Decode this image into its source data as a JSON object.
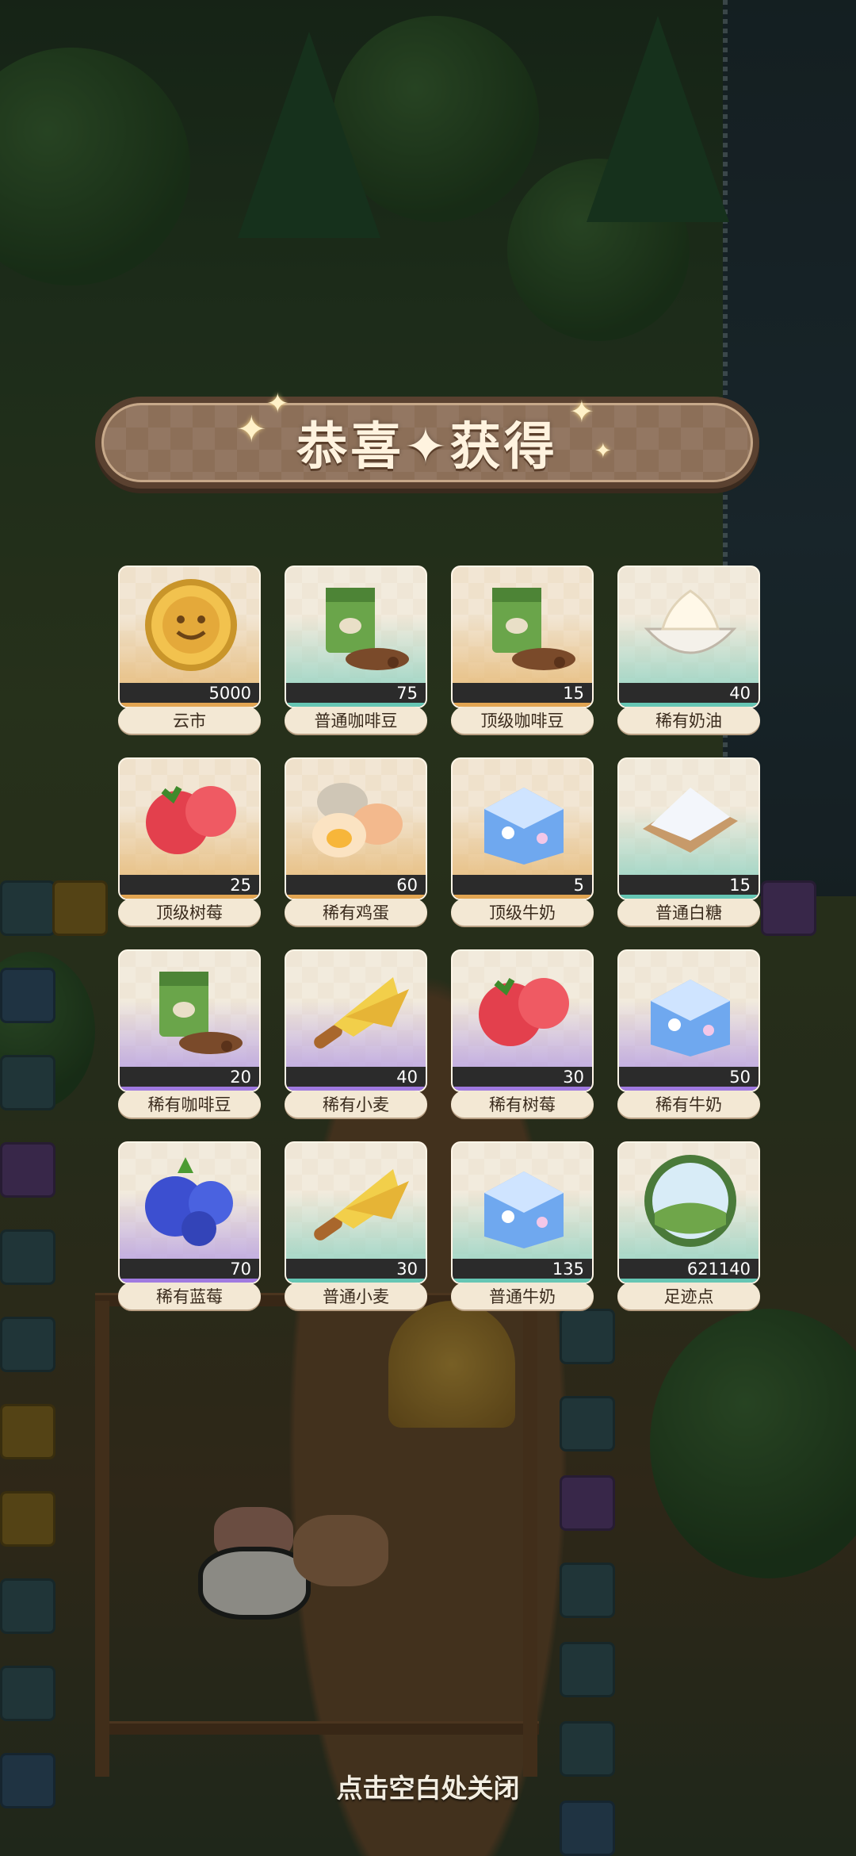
{
  "banner": {
    "title": "恭喜✦获得"
  },
  "rewards": [
    {
      "name": "云市",
      "count": "5000",
      "rarity": "gold",
      "icon": "coin-icon"
    },
    {
      "name": "普通咖啡豆",
      "count": "75",
      "rarity": "teal",
      "icon": "coffee-bean-bag-icon"
    },
    {
      "name": "顶级咖啡豆",
      "count": "15",
      "rarity": "gold",
      "icon": "coffee-bean-bag-icon"
    },
    {
      "name": "稀有奶油",
      "count": "40",
      "rarity": "teal",
      "icon": "cream-bowl-icon"
    },
    {
      "name": "顶级树莓",
      "count": "25",
      "rarity": "gold",
      "icon": "raspberry-icon"
    },
    {
      "name": "稀有鸡蛋",
      "count": "60",
      "rarity": "gold",
      "icon": "egg-icon"
    },
    {
      "name": "顶级牛奶",
      "count": "5",
      "rarity": "gold",
      "icon": "milk-carton-icon"
    },
    {
      "name": "普通白糖",
      "count": "15",
      "rarity": "teal",
      "icon": "sugar-icon"
    },
    {
      "name": "稀有咖啡豆",
      "count": "20",
      "rarity": "purple",
      "icon": "coffee-bean-bag-icon"
    },
    {
      "name": "稀有小麦",
      "count": "40",
      "rarity": "purple",
      "icon": "wheat-icon"
    },
    {
      "name": "稀有树莓",
      "count": "30",
      "rarity": "purple",
      "icon": "raspberry-icon"
    },
    {
      "name": "稀有牛奶",
      "count": "50",
      "rarity": "purple",
      "icon": "milk-carton-icon"
    },
    {
      "name": "稀有蓝莓",
      "count": "70",
      "rarity": "purple",
      "icon": "blueberry-icon"
    },
    {
      "name": "普通小麦",
      "count": "30",
      "rarity": "teal",
      "icon": "wheat-icon"
    },
    {
      "name": "普通牛奶",
      "count": "135",
      "rarity": "teal",
      "icon": "milk-carton-icon"
    },
    {
      "name": "足迹点",
      "count": "621140",
      "rarity": "teal",
      "icon": "footprint-orb-icon"
    }
  ],
  "footer": {
    "close_hint": "点击空白处关闭"
  },
  "colors": {
    "rarity_gold": "#e2a552",
    "rarity_teal": "#66c6b4",
    "rarity_purple": "#a07ae0",
    "banner": "#8c6f58"
  }
}
